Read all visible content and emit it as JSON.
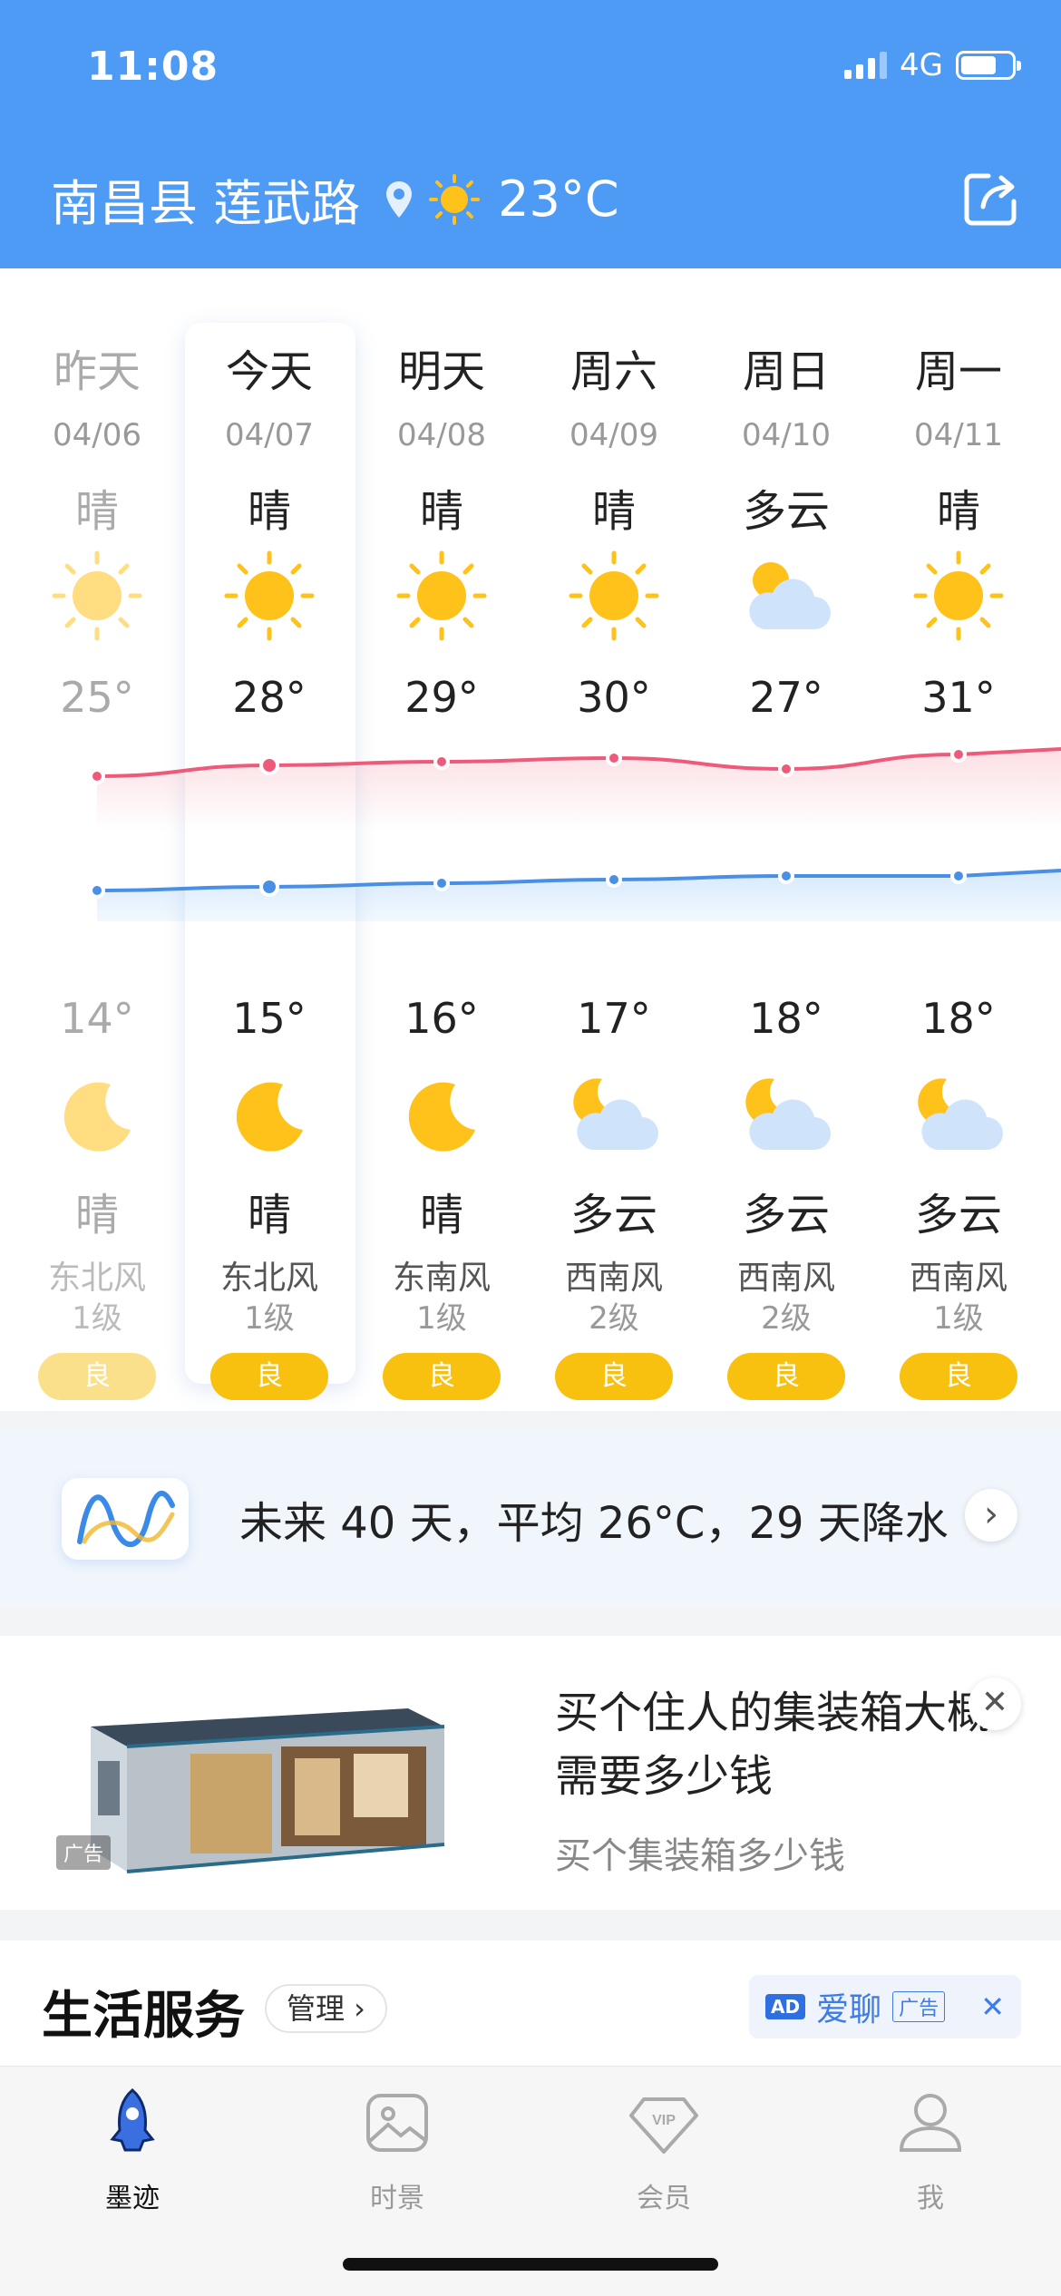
{
  "status_bar": {
    "time": "11:08",
    "network": "4G"
  },
  "header": {
    "location": "南昌县 莲武路",
    "current_temp": "23°C",
    "icons": [
      "location-pin-icon",
      "sun-icon",
      "share-icon"
    ]
  },
  "forecast": [
    {
      "day": "昨天",
      "date": "04/06",
      "cond_day": "晴",
      "day_icon": "sun",
      "high": "25°",
      "low": "14°",
      "night_icon": "moon",
      "cond_night": "晴",
      "wind": "东北风",
      "wind_level": "1级",
      "aqi": "良",
      "past": true
    },
    {
      "day": "今天",
      "date": "04/07",
      "cond_day": "晴",
      "day_icon": "sun",
      "high": "28°",
      "low": "15°",
      "night_icon": "moon",
      "cond_night": "晴",
      "wind": "东北风",
      "wind_level": "1级",
      "aqi": "良",
      "today": true
    },
    {
      "day": "明天",
      "date": "04/08",
      "cond_day": "晴",
      "day_icon": "sun",
      "high": "29°",
      "low": "16°",
      "night_icon": "moon",
      "cond_night": "晴",
      "wind": "东南风",
      "wind_level": "1级",
      "aqi": "良"
    },
    {
      "day": "周六",
      "date": "04/09",
      "cond_day": "晴",
      "day_icon": "sun",
      "high": "30°",
      "low": "17°",
      "night_icon": "moon-cloud",
      "cond_night": "多云",
      "wind": "西南风",
      "wind_level": "2级",
      "aqi": "良"
    },
    {
      "day": "周日",
      "date": "04/10",
      "cond_day": "多云",
      "day_icon": "sun-cloud",
      "high": "27°",
      "low": "18°",
      "night_icon": "moon-cloud",
      "cond_night": "多云",
      "wind": "西南风",
      "wind_level": "2级",
      "aqi": "良"
    },
    {
      "day": "周一",
      "date": "04/11",
      "cond_day": "晴",
      "day_icon": "sun",
      "high": "31°",
      "low": "18°",
      "night_icon": "moon-cloud",
      "cond_night": "多云",
      "wind": "西南风",
      "wind_level": "1级",
      "aqi": "良"
    }
  ],
  "forty_day": {
    "text": "未来 40 天，平均 26°C，29 天降水"
  },
  "ad": {
    "title": "买个住人的集装箱大概需要多少钱",
    "subtitle": "买个集装箱多少钱",
    "tag": "广告"
  },
  "services": {
    "title": "生活服务",
    "manage": "管理 ›",
    "ad_badge": "AD",
    "ad_name": "爱聊",
    "ad_label": "广告"
  },
  "tabs": [
    {
      "label": "墨迹",
      "icon": "rocket-icon",
      "active": true
    },
    {
      "label": "时景",
      "icon": "photo-icon",
      "active": false
    },
    {
      "label": "会员",
      "icon": "vip-diamond-icon",
      "active": false
    },
    {
      "label": "我",
      "icon": "user-icon",
      "active": false
    }
  ],
  "colors": {
    "header": "#4d9bf5",
    "high_curve": "#ef8c9b",
    "low_curve": "#6fb0f2",
    "aqi": "#f8c110"
  }
}
